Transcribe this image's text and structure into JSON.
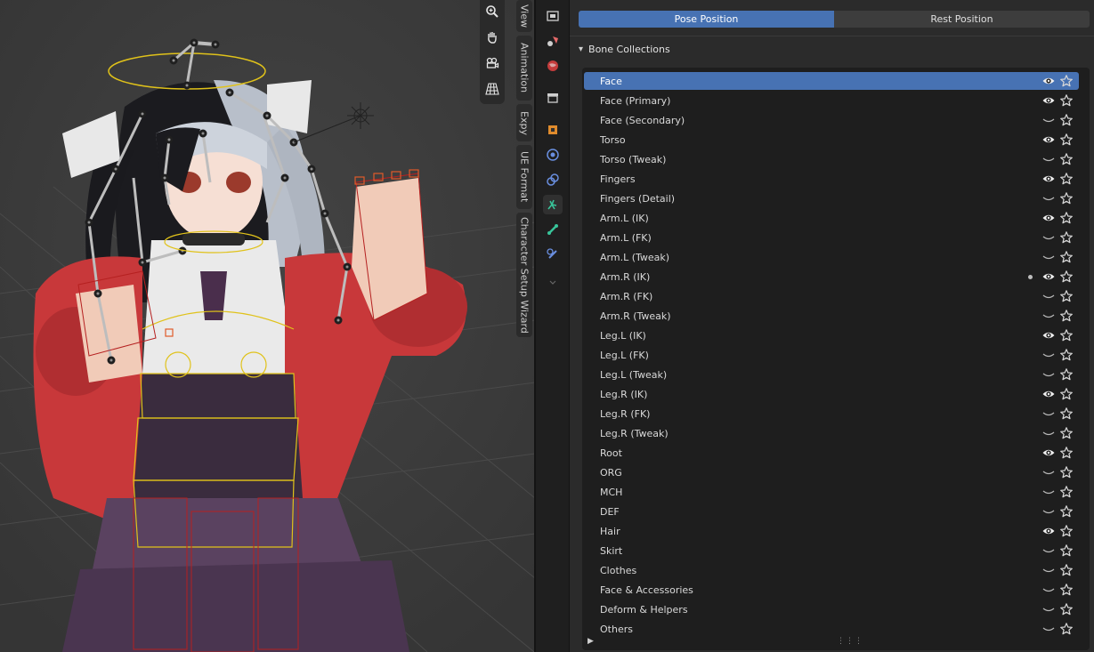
{
  "viewport": {
    "tabs": [
      "View",
      "Animation",
      "Expy",
      "UE Format",
      "Character Setup Wizard"
    ],
    "nav_icons": [
      "zoom-icon",
      "pan-hand-icon",
      "camera-icon",
      "grid-perspective-icon"
    ]
  },
  "properties_tabs": [
    "render-icon",
    "scene-icon",
    "world-icon",
    "collection-icon",
    "object-icon",
    "physics-icon",
    "constraint-icon",
    "armature-data-icon",
    "bone-icon",
    "bone-constraint-icon",
    "expand-icon"
  ],
  "pose": {
    "pose_label": "Pose Position",
    "rest_label": "Rest Position",
    "selected": "Pose Position"
  },
  "bone_collections": {
    "title": "Bone Collections",
    "items": [
      {
        "label": "Face",
        "visible": true,
        "selected": true
      },
      {
        "label": "Face (Primary)",
        "visible": true
      },
      {
        "label": "Face (Secondary)",
        "visible": false
      },
      {
        "label": "Torso",
        "visible": true
      },
      {
        "label": "Torso (Tweak)",
        "visible": false
      },
      {
        "label": "Fingers",
        "visible": true
      },
      {
        "label": "Fingers (Detail)",
        "visible": false
      },
      {
        "label": "Arm.L (IK)",
        "visible": true
      },
      {
        "label": "Arm.L (FK)",
        "visible": false
      },
      {
        "label": "Arm.L (Tweak)",
        "visible": false
      },
      {
        "label": "Arm.R (IK)",
        "visible": true,
        "active": true
      },
      {
        "label": "Arm.R (FK)",
        "visible": false
      },
      {
        "label": "Arm.R (Tweak)",
        "visible": false
      },
      {
        "label": "Leg.L (IK)",
        "visible": true
      },
      {
        "label": "Leg.L (FK)",
        "visible": false
      },
      {
        "label": "Leg.L (Tweak)",
        "visible": false
      },
      {
        "label": "Leg.R (IK)",
        "visible": true
      },
      {
        "label": "Leg.R (FK)",
        "visible": false
      },
      {
        "label": "Leg.R (Tweak)",
        "visible": false
      },
      {
        "label": "Root",
        "visible": true
      },
      {
        "label": "ORG",
        "visible": false
      },
      {
        "label": "MCH",
        "visible": false
      },
      {
        "label": "DEF",
        "visible": false
      },
      {
        "label": "Hair",
        "visible": true
      },
      {
        "label": "Skirt",
        "visible": false
      },
      {
        "label": "Clothes",
        "visible": false
      },
      {
        "label": "Face & Accessories",
        "visible": false
      },
      {
        "label": "Deform & Helpers",
        "visible": false
      },
      {
        "label": "Others",
        "visible": false
      }
    ]
  },
  "colors": {
    "accent": "#4772b3",
    "panel": "#2b2b2b",
    "list_bg": "#1e1e1e",
    "bone_yellow": "#e0c21a",
    "bone_red": "#b52020",
    "jacket_red": "#c8383a"
  }
}
